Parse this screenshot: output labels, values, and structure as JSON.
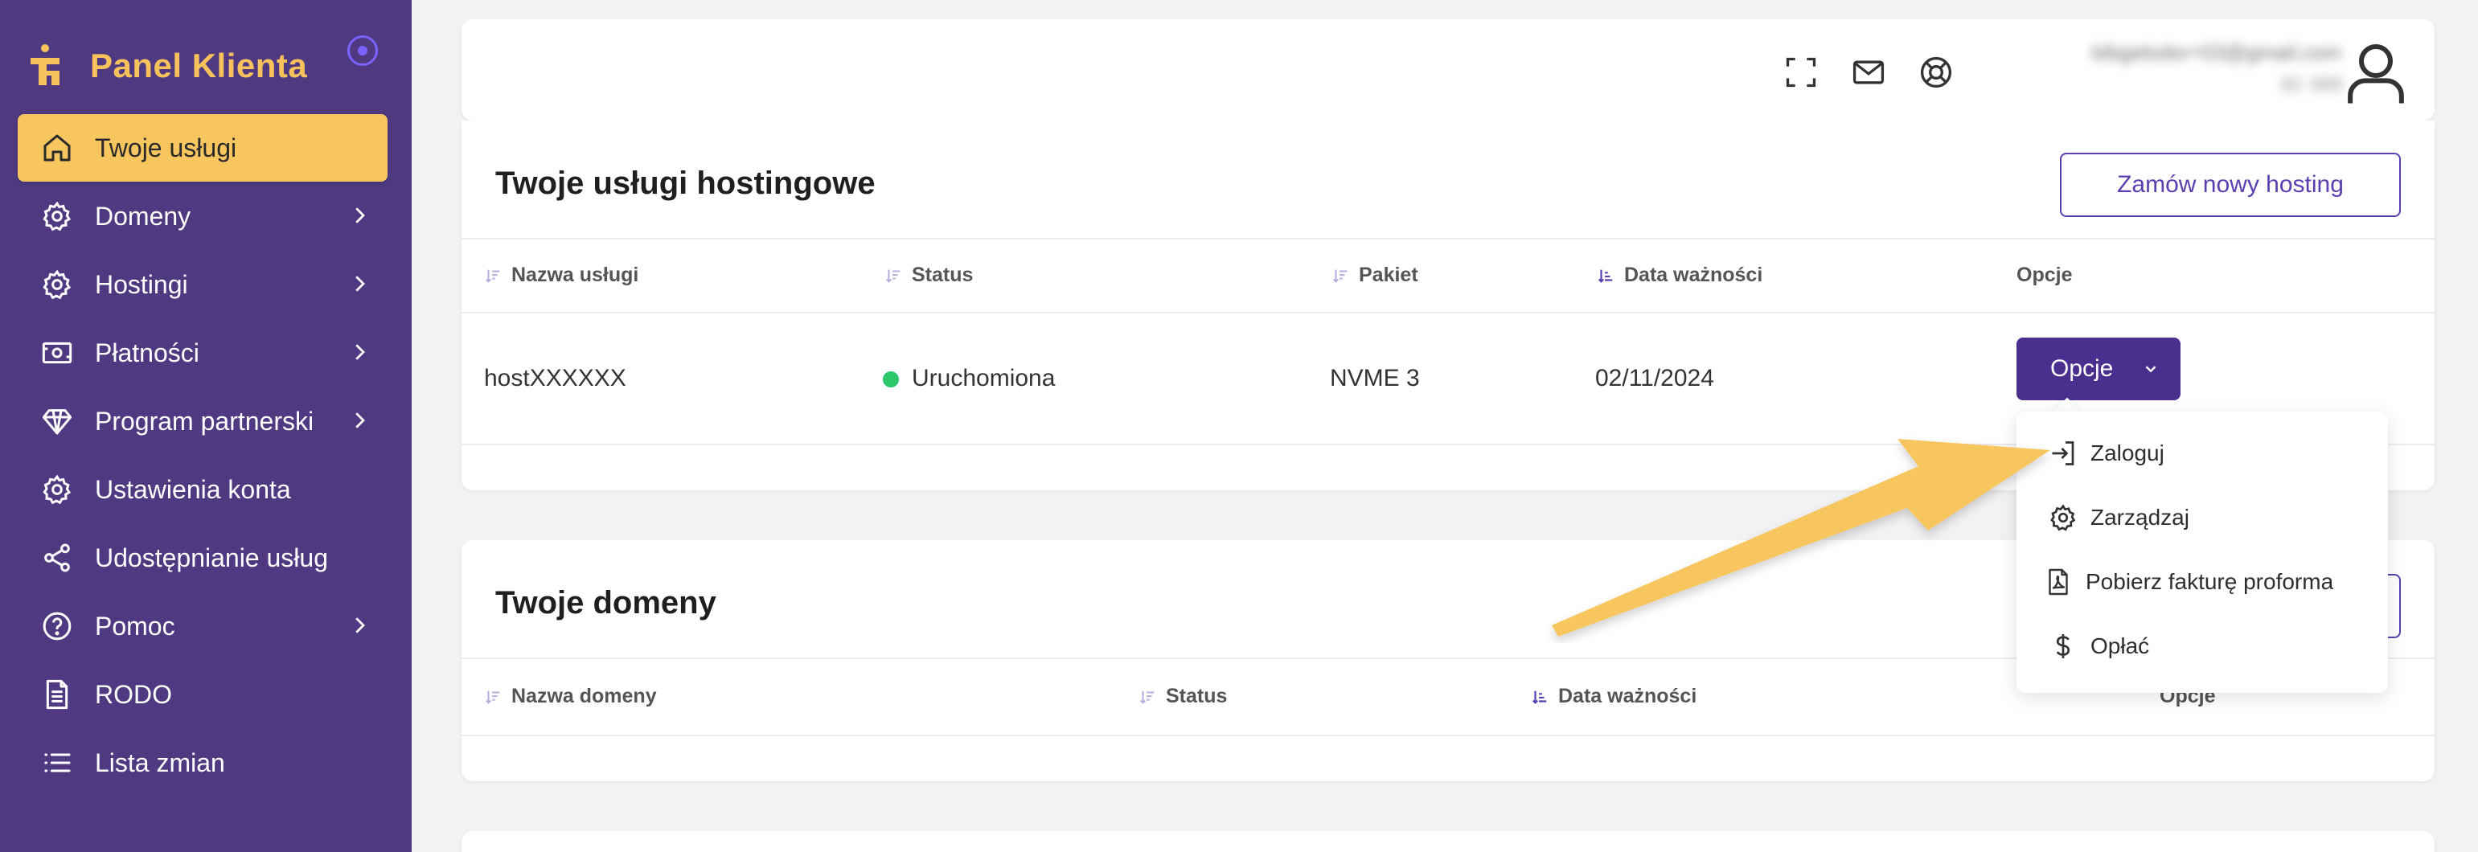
{
  "sidebar": {
    "brand_title": "Panel Klienta",
    "items": [
      {
        "label": "Twoje usługi",
        "icon": "home-icon",
        "active": true,
        "has_chevron": false
      },
      {
        "label": "Domeny",
        "icon": "gear-icon",
        "active": false,
        "has_chevron": true
      },
      {
        "label": "Hostingi",
        "icon": "gear-icon",
        "active": false,
        "has_chevron": true
      },
      {
        "label": "Płatności",
        "icon": "banknote-icon",
        "active": false,
        "has_chevron": true
      },
      {
        "label": "Program partnerski",
        "icon": "diamond-icon",
        "active": false,
        "has_chevron": true
      },
      {
        "label": "Ustawienia konta",
        "icon": "gear-icon",
        "active": false,
        "has_chevron": false
      },
      {
        "label": "Udostępnianie usług",
        "icon": "share-icon",
        "active": false,
        "has_chevron": false
      },
      {
        "label": "Pomoc",
        "icon": "help-circle-icon",
        "active": false,
        "has_chevron": true
      },
      {
        "label": "RODO",
        "icon": "document-icon",
        "active": false,
        "has_chevron": false
      },
      {
        "label": "Lista zmian",
        "icon": "list-icon",
        "active": false,
        "has_chevron": false
      }
    ]
  },
  "header": {
    "user_email": "ktbgelodor+03@gmail.com",
    "user_sub": "ID: 000"
  },
  "hosting": {
    "title": "Twoje usługi hostingowe",
    "order_button": "Zamów nowy hosting",
    "columns": [
      "Nazwa usługi",
      "Status",
      "Pakiet",
      "Data ważności",
      "Opcje"
    ],
    "row": {
      "name": "hostXXXXXX",
      "status": "Uruchomiona",
      "package": "NVME 3",
      "expiry": "02/11/2024",
      "options_button": "Opcje"
    }
  },
  "dropdown": {
    "items": [
      {
        "label": "Zaloguj",
        "icon": "login-icon"
      },
      {
        "label": "Zarządzaj",
        "icon": "gear-icon"
      },
      {
        "label": "Pobierz fakturę proforma",
        "icon": "pdf-file-icon"
      },
      {
        "label": "Opłać",
        "icon": "dollar-icon"
      }
    ]
  },
  "domains": {
    "title": "Twoje domeny",
    "columns": [
      "Nazwa domeny",
      "Status",
      "Data ważności",
      "Opcje"
    ]
  },
  "colors": {
    "sidebar_bg": "#4f3a82",
    "active_item": "#f7c65f",
    "brand_text": "#f7c25c",
    "primary": "#4a2f8e",
    "status_green": "#2bc76b",
    "arrow": "#f7c65f"
  }
}
